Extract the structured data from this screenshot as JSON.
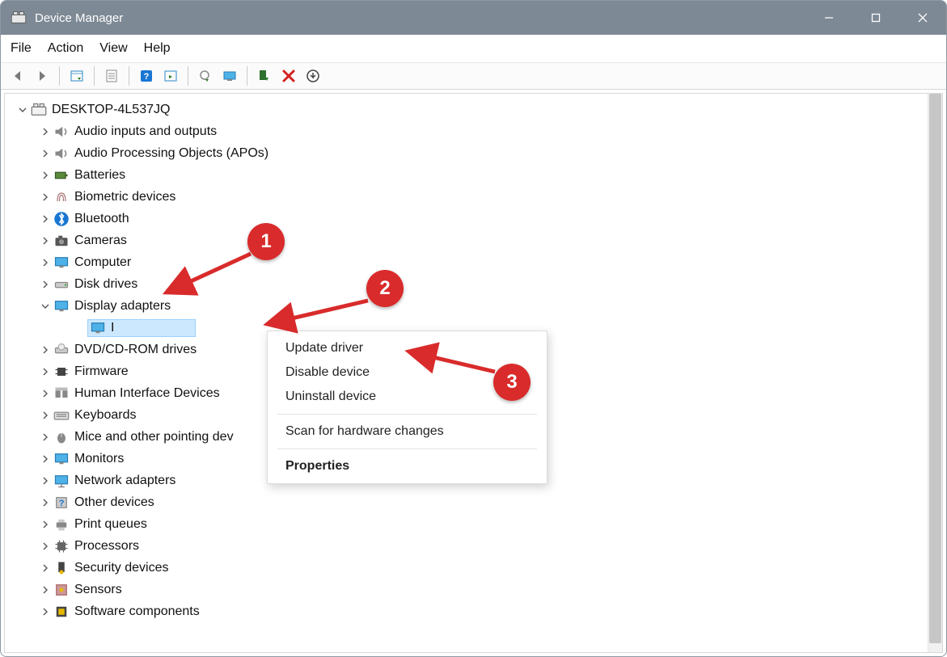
{
  "title": "Device Manager",
  "menu": {
    "file": "File",
    "action": "Action",
    "view": "View",
    "help": "Help"
  },
  "root": "DESKTOP-4L537JQ",
  "nodes": {
    "audio_io": "Audio inputs and outputs",
    "apo": "Audio Processing Objects (APOs)",
    "batteries": "Batteries",
    "biometric": "Biometric devices",
    "bluetooth": "Bluetooth",
    "cameras": "Cameras",
    "computer": "Computer",
    "disk": "Disk drives",
    "display": "Display adapters",
    "display_child": "I",
    "dvd": "DVD/CD-ROM drives",
    "firmware": "Firmware",
    "hid": "Human Interface Devices",
    "keyboards": "Keyboards",
    "mice": "Mice and other pointing dev",
    "monitors": "Monitors",
    "network": "Network adapters",
    "other": "Other devices",
    "print": "Print queues",
    "processors": "Processors",
    "security": "Security devices",
    "sensors": "Sensors",
    "software": "Software components"
  },
  "context": {
    "update": "Update driver",
    "disable": "Disable device",
    "uninstall": "Uninstall device",
    "scan": "Scan for hardware changes",
    "properties": "Properties"
  },
  "markers": {
    "m1": "1",
    "m2": "2",
    "m3": "3"
  }
}
